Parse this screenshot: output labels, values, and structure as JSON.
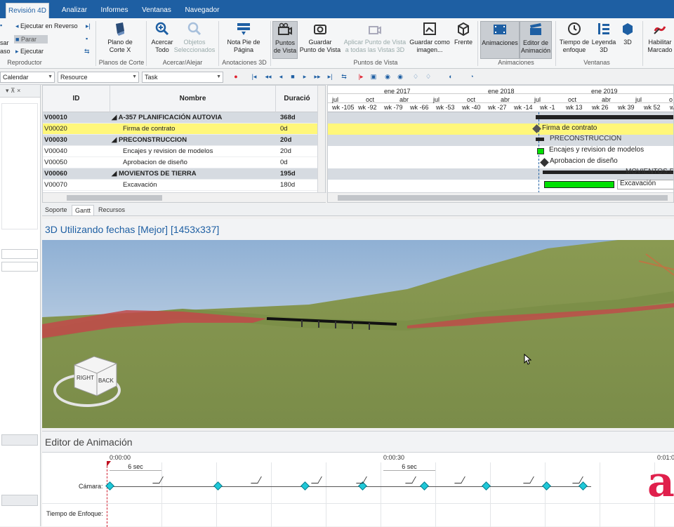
{
  "tabs": [
    "Revisión 4D",
    "Analizar",
    "Informes",
    "Ventanas",
    "Navegador"
  ],
  "ribbon": {
    "reproductor": {
      "ejecutar_reverso": "Ejecutar en Reverso",
      "parar": "Parar",
      "ejecutar": "Ejecutar",
      "pasar": "sar",
      "paso": "aso",
      "group": "Reproductor"
    },
    "plano_corte": {
      "label": "Plano de\nCorte X",
      "group": "Planos de Corte"
    },
    "acercar_todo": "Acercar\nTodo",
    "objetos_sel": "Objetos\nSeleccionados",
    "acercar_group": "Acercar/Alejar",
    "nota_pie": "Nota Pie de\nPágina",
    "anotaciones_group": "Anotaciones 3D",
    "puntos_vista": "Puntos\nde Vista",
    "guardar_pv": "Guardar\nPunto de Vista",
    "aplicar_pv": "Aplicar Punto de Vista\na todas las Vistas 3D",
    "guardar_imagen": "Guardar como\nimagen...",
    "frente": "Frente",
    "puntos_group": "Puntos de Vista",
    "animaciones": "Animaciones",
    "editor_anim": "Editor de\nAnimación",
    "animaciones_group": "Animaciones",
    "tiempo_enfoque": "Tiempo de\nenfoque",
    "leyenda3d": "Leyenda\n3D",
    "btn3d": "3D",
    "ventanas_group": "Ventanas",
    "habilitar": "Habilitar\nMarcado"
  },
  "toolbar2": {
    "calendar": "Calendar",
    "resource": "Resource",
    "task": "Task"
  },
  "leftpane": {
    "pin": "▾ ⊼ ×"
  },
  "grid": {
    "headers": {
      "id": "ID",
      "nombre": "Nombre",
      "duracion": "Duració"
    },
    "rows": [
      {
        "id": "V00010",
        "name": "◢ A-357 PLANIFICACIÓN AUTOVIA",
        "dur": "368d",
        "type": "sum"
      },
      {
        "id": "V00020",
        "name": "Firma de contrato",
        "dur": "0d",
        "type": "hl"
      },
      {
        "id": "V00030",
        "name": "◢ PRECONSTRUCCION",
        "dur": "20d",
        "type": "sum"
      },
      {
        "id": "V00040",
        "name": "Encajes y revision de modelos",
        "dur": "20d",
        "type": "norm"
      },
      {
        "id": "V00050",
        "name": "Aprobacion de diseño",
        "dur": "0d",
        "type": "norm"
      },
      {
        "id": "V00060",
        "name": "◢ MOVIENTOS DE TIERRA",
        "dur": "195d",
        "type": "sum"
      },
      {
        "id": "V00070",
        "name": "Excavación",
        "dur": "180d",
        "type": "norm"
      }
    ]
  },
  "gantt": {
    "years": [
      "ene 2017",
      "ene 2018",
      "ene 2019"
    ],
    "quarters": [
      "jul",
      "oct",
      "abr",
      "jul",
      "oct",
      "abr",
      "jul",
      "oct",
      "abr",
      "jul",
      "o"
    ],
    "weeks": [
      "wk -105",
      "wk -92",
      "wk -79",
      "wk -66",
      "wk -53",
      "wk -40",
      "wk -27",
      "wk -14",
      "wk -1",
      "wk 13",
      "wk 26",
      "wk 39",
      "wk 52",
      "wk"
    ],
    "labels": [
      "Firma de contrato",
      "PRECONSTRUCCION",
      "Encajes y revision de modelos",
      "Aprobacion de diseño",
      "MOVIENTOS D",
      "Excavación"
    ]
  },
  "bottom_tabs": [
    "Soporte",
    "Gantt",
    "Recursos"
  ],
  "view3d_title": "3D Utilizando fechas [Mejor] [1453x337]",
  "navcube": {
    "right": "RIGHT",
    "back": "BACK"
  },
  "anim": {
    "title": "Editor de Animación",
    "times": [
      "0:00:00",
      "0:00:30",
      "0:01:0"
    ],
    "six_sec": "6 sec",
    "camara": "Cámara:",
    "tiempo_enfoque": "Tiempo de Enfoque:"
  },
  "logo_letter": "a",
  "colors": {
    "accent": "#1e5fa3",
    "highlight": "#fff77a",
    "bar_green": "#00e000",
    "keyframe": "#1ec8d8",
    "logo": "#e0204c"
  }
}
